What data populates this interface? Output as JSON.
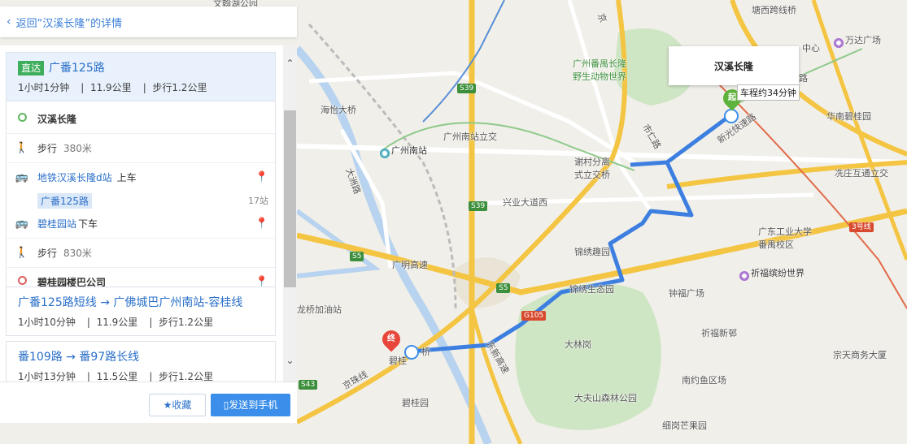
{
  "back": {
    "label": "返回“汉溪长隆”的详情"
  },
  "routes": [
    {
      "tag": "直达",
      "title": "广番125路",
      "duration": "1小时1分钟",
      "distance": "11.9公里",
      "walk": "步行1.2公里",
      "steps": {
        "origin": "汉溪长隆",
        "walk1_label": "步行",
        "walk1_dist": "380米",
        "board_station": "地铁汉溪长隆d站",
        "board_action": "上车",
        "line": "广番125路",
        "stops": "17站",
        "alight_station": "碧桂园站",
        "alight_action": "下车",
        "walk2_label": "步行",
        "walk2_dist": "830米",
        "destination": "碧桂园楼巴公司"
      }
    },
    {
      "title": "广番125路短线 → 广佛城巴广州南站-容桂线",
      "duration": "1小时10分钟",
      "distance": "11.9公里",
      "walk": "步行1.2公里"
    },
    {
      "title": "番109路 → 番97路长线",
      "duration": "1小时13分钟",
      "distance": "11.5公里",
      "walk": "步行1.2公里"
    }
  ],
  "buttons": {
    "favorite": "收藏",
    "send": "发送到手机"
  },
  "map": {
    "dest_card": "汉溪长隆",
    "duration_tip": "车程约34分钟",
    "marker_start": "起",
    "marker_end": "终",
    "labels": {
      "wenhan": "文翰湖公园",
      "tangxi": "塘西跨线桥",
      "wanda": "万达广场",
      "zoo1": "广州番禺长隆",
      "zoo2": "野生动物世界",
      "haiyi": "海怡大桥",
      "nanzhanli": "广州南站立交",
      "nanzhan": "广州南站",
      "xieli": "谢村分离",
      "xieli2": "式立交桥",
      "xinguang": "新光快速路",
      "huanan": "华南碧桂园",
      "xianzhuang": "冼庄互通立交",
      "xingye": "兴业大道西",
      "gongda1": "广东工业大学",
      "gongda2": "番禺校区",
      "jinxiu": "锦绣趣园",
      "jinxiushengtai": "锦绣生态园",
      "qifu": "祈福缤纷世界",
      "zhongfu": "钟福广场",
      "guangming": "广明高速",
      "longqiao": "龙桥加油站",
      "dalin": "大林岗",
      "nanyue": "南约鱼区场",
      "qifuxin": "祈福新邨",
      "zongtian": "宗天商务大厦",
      "dafu": "大夫山森林公园",
      "xi": "细岗芒果园",
      "biguiyuan": "碧桂园",
      "jingzhu": "京珠线",
      "dongxin": "东新高速",
      "jing": "京",
      "dazhou": "大洲路",
      "jinglu": "市仁路",
      "s39": "S39",
      "s5": "S5",
      "s43": "S43",
      "g105": "G105",
      "line3": "3号线",
      "zhongxin": "中心",
      "lu": "路",
      "qiao": "桥",
      "bigui": "碧桂"
    }
  }
}
